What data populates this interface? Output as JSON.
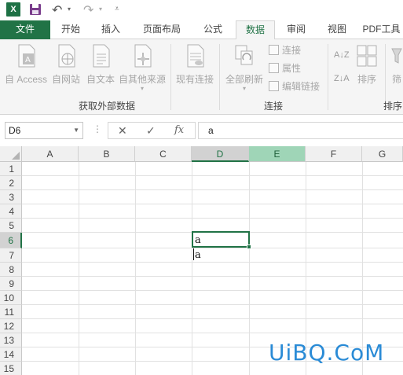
{
  "qat": {
    "logo": "X"
  },
  "tabs": [
    {
      "label": "文件"
    },
    {
      "label": "开始"
    },
    {
      "label": "插入"
    },
    {
      "label": "页面布局"
    },
    {
      "label": "公式"
    },
    {
      "label": "数据"
    },
    {
      "label": "审阅"
    },
    {
      "label": "视图"
    },
    {
      "label": "PDF工具"
    }
  ],
  "ribbon": {
    "get_external": {
      "label": "获取外部数据",
      "buttons": [
        "自 Access",
        "自网站",
        "自文本",
        "自其他来源"
      ]
    },
    "existing_connections": "现有连接",
    "connections": {
      "label": "连接",
      "refresh_all": "全部刷新",
      "connections_btn": "连接",
      "properties": "属性",
      "edit_links": "编辑链接"
    },
    "sort_filter": {
      "label": "排序",
      "sort": "排序",
      "filter_partial": "筛"
    }
  },
  "formula_bar": {
    "name_box": "D6",
    "cancel": "✕",
    "enter": "✓",
    "fx": "fx",
    "value": "a"
  },
  "grid": {
    "columns": [
      "A",
      "B",
      "C",
      "D",
      "E",
      "F",
      "G"
    ],
    "rows": [
      "1",
      "2",
      "3",
      "4",
      "5",
      "6",
      "7",
      "8",
      "9",
      "10",
      "11",
      "12",
      "13",
      "14",
      "15"
    ],
    "cells": {
      "D6": "a",
      "D7": "a"
    }
  },
  "watermark": "UiBQ.CoM",
  "colors": {
    "accent": "#217346",
    "selected_col": "#9fd5b7"
  }
}
